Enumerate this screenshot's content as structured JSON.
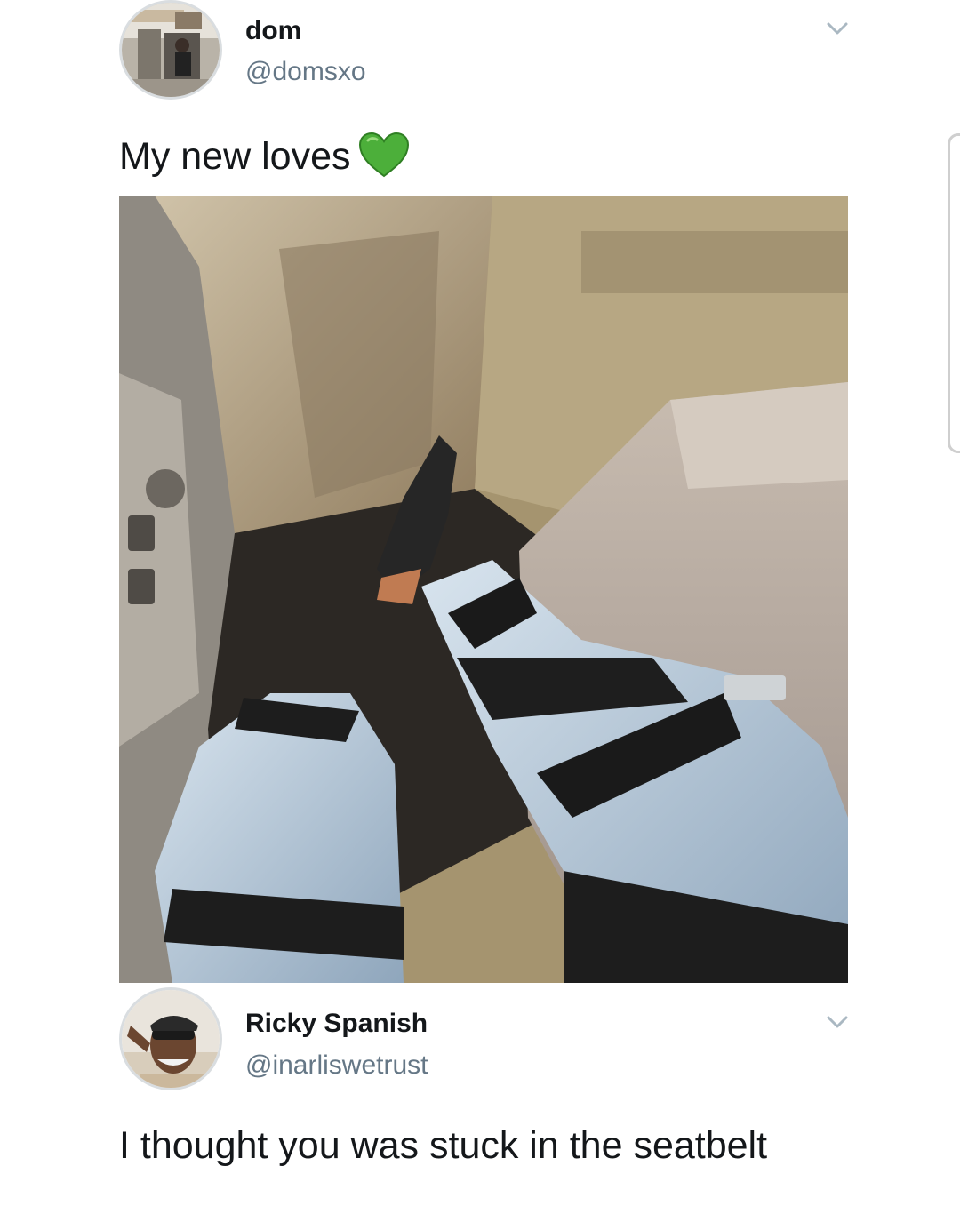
{
  "tweets": [
    {
      "author": {
        "name": "dom",
        "handle": "@domsxo"
      },
      "text": "My new loves",
      "emoji_icon": "green-heart-icon",
      "has_media": true,
      "menu_icon": "chevron-down-icon"
    },
    {
      "author": {
        "name": "Ricky Spanish",
        "handle": "@inarliswetrust"
      },
      "text": "I thought you was stuck in the seatbelt",
      "menu_icon": "chevron-down-icon"
    }
  ],
  "colors": {
    "text_primary": "#14171a",
    "text_secondary": "#657786",
    "emoji_green": "#4caf3a",
    "background": "#ffffff"
  }
}
